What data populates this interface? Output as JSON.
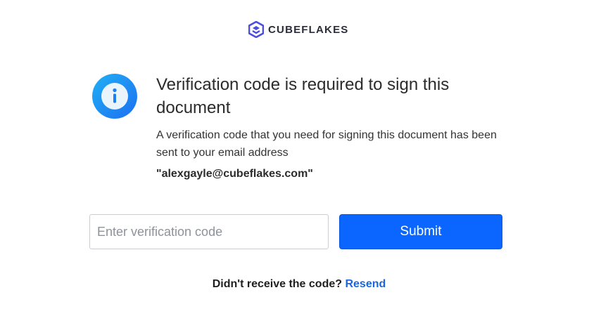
{
  "brand": {
    "name": "CUBEFLAKES",
    "logo_icon": "cube-logo-icon",
    "accent_color": "#4a4de0"
  },
  "notice": {
    "icon": "info-icon",
    "heading": "Verification code is required to sign this document",
    "description": "A verification code that you need for signing this document has been sent to your email address",
    "email": "\"alexgayle@cubeflakes.com\""
  },
  "form": {
    "code_placeholder": "Enter verification code",
    "code_value": "",
    "submit_label": "Submit",
    "submit_color": "#0a66ff"
  },
  "resend": {
    "prompt": "Didn't receive the code?",
    "link_label": "Resend",
    "link_color": "#1a66e0"
  }
}
